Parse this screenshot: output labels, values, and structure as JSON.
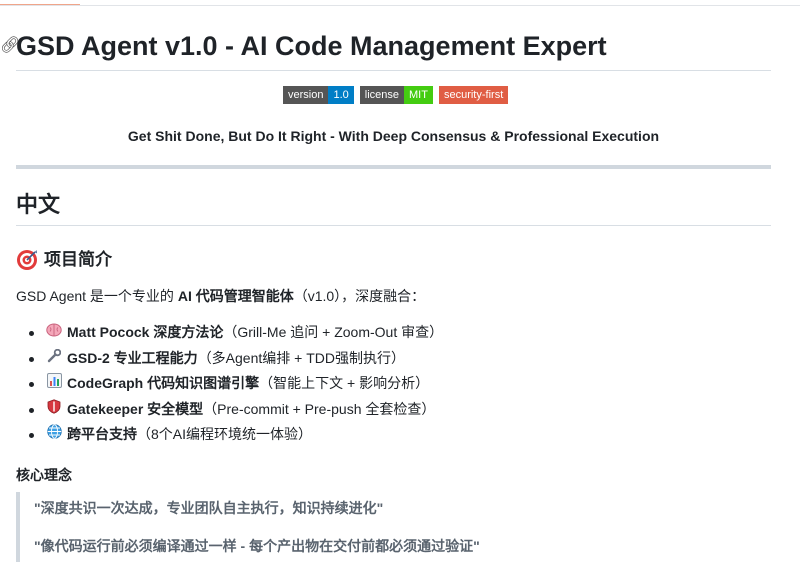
{
  "title": {
    "lead_icon": "link-icon",
    "text": "GSD Agent v1.0 - AI Code Management Expert"
  },
  "badges": [
    {
      "label": "version",
      "value": "1.0",
      "color": "#007ec6"
    },
    {
      "label": "license",
      "value": "MIT",
      "color": "#44cc11"
    },
    {
      "label": "security-first",
      "color": "#e05d44"
    }
  ],
  "tagline": "Get Shit Done, But Do It Right - With Deep Consensus & Professional Execution",
  "section": {
    "heading": "中文",
    "intro_heading": {
      "icon": "target-icon",
      "text": "项目简介"
    },
    "intro": {
      "prefix": "GSD Agent 是一个专业的 ",
      "bold": "AI 代码管理智能体",
      "suffix": "（v1.0），深度融合："
    },
    "features": [
      {
        "icon": "brain-icon",
        "bold": "Matt Pocock 深度方法论",
        "rest": "（Grill-Me 追问 + Zoom-Out 审查）"
      },
      {
        "icon": "wrench-icon",
        "bold": "GSD-2 专业工程能力",
        "rest": "（多Agent编排 + TDD强制执行）"
      },
      {
        "icon": "chart-icon",
        "bold": "CodeGraph 代码知识图谱引擎",
        "rest": "（智能上下文 + 影响分析）"
      },
      {
        "icon": "shield-icon",
        "bold": "Gatekeeper 安全模型",
        "rest": "（Pre-commit + Pre-push 全套检查）"
      },
      {
        "icon": "globe-icon",
        "bold": "跨平台支持",
        "rest": "（8个AI编程环境统一体验）"
      }
    ],
    "core_heading": "核心理念",
    "quotes": [
      "\"深度共识一次达成，专业团队自主执行，知识持续进化\"",
      "\"像代码运行前必须编译通过一样 - 每个产出物在交付前都必须通过验证\""
    ]
  }
}
